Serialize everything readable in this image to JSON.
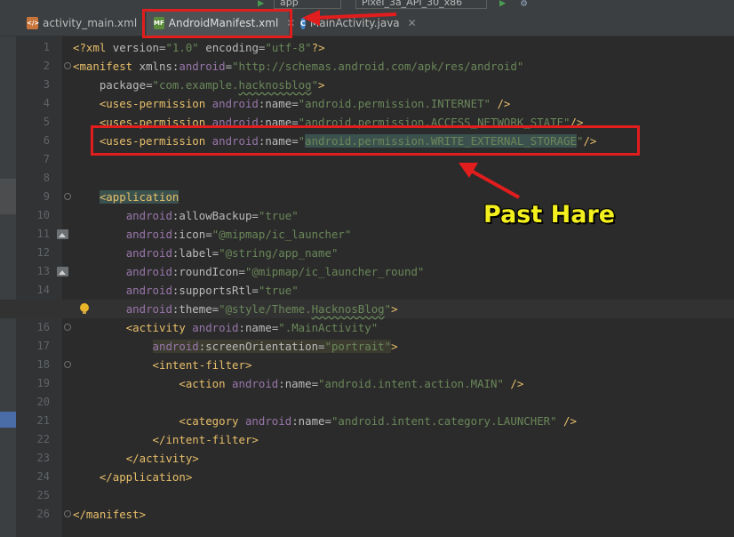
{
  "toolbar": {
    "run_config": "app",
    "device": "Pixel_3a_API_30_x86",
    "icons": [
      "hammer-icon",
      "run-icon",
      "debug-icon"
    ]
  },
  "tabs": [
    {
      "label": "activity_main.xml",
      "icon": "xml-file-icon",
      "active": false
    },
    {
      "label": "AndroidManifest.xml",
      "icon": "manifest-file-icon",
      "active": true
    },
    {
      "label": "MainActivity.java",
      "icon": "java-class-icon",
      "active": false
    }
  ],
  "editor": {
    "line_numbers": [
      "1",
      "2",
      "3",
      "4",
      "5",
      "6",
      "7",
      "8",
      "9",
      "10",
      "11",
      "12",
      "13",
      "14",
      "15",
      "16",
      "17",
      "18",
      "19",
      "20",
      "21",
      "22",
      "23",
      "24",
      "25",
      "26"
    ],
    "current_line": "15",
    "lines": [
      {
        "indent": "",
        "parts": [
          {
            "t": "<?xml ",
            "c": "pi"
          },
          {
            "t": "version",
            "c": "attr"
          },
          {
            "t": "=",
            "c": "attr"
          },
          {
            "t": "\"1.0\"",
            "c": "val"
          },
          {
            "t": " ",
            "c": "attr"
          },
          {
            "t": "encoding",
            "c": "attr"
          },
          {
            "t": "=",
            "c": "attr"
          },
          {
            "t": "\"utf-8\"",
            "c": "val"
          },
          {
            "t": "?>",
            "c": "pi"
          }
        ]
      },
      {
        "indent": "",
        "parts": [
          {
            "t": "<manifest ",
            "c": "tag"
          },
          {
            "t": "xmlns:",
            "c": "attr"
          },
          {
            "t": "android",
            "c": "ns"
          },
          {
            "t": "=",
            "c": "attr"
          },
          {
            "t": "\"http://schemas.android.com/apk/res/android\"",
            "c": "val"
          }
        ]
      },
      {
        "indent": "    ",
        "parts": [
          {
            "t": "package",
            "c": "attr"
          },
          {
            "t": "=",
            "c": "attr"
          },
          {
            "t": "\"com.example.",
            "c": "val"
          },
          {
            "t": "hacknosblog",
            "c": "val-ul"
          },
          {
            "t": "\"",
            "c": "val"
          },
          {
            "t": ">",
            "c": "tag"
          }
        ]
      },
      {
        "indent": "    ",
        "parts": [
          {
            "t": "<uses-permission ",
            "c": "tag"
          },
          {
            "t": "android",
            "c": "ns"
          },
          {
            "t": ":name=",
            "c": "attr"
          },
          {
            "t": "\"android.permission.INTERNET\"",
            "c": "val"
          },
          {
            "t": " />",
            "c": "tag"
          }
        ]
      },
      {
        "indent": "    ",
        "parts": [
          {
            "t": "<uses-permission ",
            "c": "tag"
          },
          {
            "t": "android",
            "c": "ns"
          },
          {
            "t": ":name=",
            "c": "attr"
          },
          {
            "t": "\"android.permission.ACCESS_NETWORK_STATE\"",
            "c": "val"
          },
          {
            "t": "/>",
            "c": "tag"
          }
        ]
      },
      {
        "indent": "    ",
        "parts": [
          {
            "t": "<uses-permission ",
            "c": "tag"
          },
          {
            "t": "android",
            "c": "ns"
          },
          {
            "t": ":name=",
            "c": "attr"
          },
          {
            "t": "\"",
            "c": "val"
          },
          {
            "t": "android.permission.WRITE_EXTERNAL_STORAGE",
            "c": "val-hl"
          },
          {
            "t": "\"",
            "c": "val"
          },
          {
            "t": "/>",
            "c": "tag"
          }
        ]
      },
      {
        "indent": "",
        "parts": []
      },
      {
        "indent": "",
        "parts": []
      },
      {
        "indent": "    ",
        "parts": [
          {
            "t": "<application",
            "c": "tag-hl"
          }
        ]
      },
      {
        "indent": "        ",
        "parts": [
          {
            "t": "android",
            "c": "ns"
          },
          {
            "t": ":allowBackup=",
            "c": "attr"
          },
          {
            "t": "\"true\"",
            "c": "val"
          }
        ]
      },
      {
        "indent": "        ",
        "parts": [
          {
            "t": "android",
            "c": "ns"
          },
          {
            "t": ":icon=",
            "c": "attr"
          },
          {
            "t": "\"@mipmap/ic_launcher\"",
            "c": "val"
          }
        ]
      },
      {
        "indent": "        ",
        "parts": [
          {
            "t": "android",
            "c": "ns"
          },
          {
            "t": ":label=",
            "c": "attr"
          },
          {
            "t": "\"@string/app_name\"",
            "c": "val"
          }
        ]
      },
      {
        "indent": "        ",
        "parts": [
          {
            "t": "android",
            "c": "ns"
          },
          {
            "t": ":roundIcon=",
            "c": "attr"
          },
          {
            "t": "\"@mipmap/ic_launcher_round\"",
            "c": "val"
          }
        ]
      },
      {
        "indent": "        ",
        "parts": [
          {
            "t": "android",
            "c": "ns"
          },
          {
            "t": ":supportsRtl=",
            "c": "attr"
          },
          {
            "t": "\"true\"",
            "c": "val"
          }
        ]
      },
      {
        "indent": "        ",
        "parts": [
          {
            "t": "android",
            "c": "ns"
          },
          {
            "t": ":theme=",
            "c": "attr"
          },
          {
            "t": "\"@style/Theme.",
            "c": "val"
          },
          {
            "t": "HacknosBlog",
            "c": "val-ul"
          },
          {
            "t": "\"",
            "c": "val"
          },
          {
            "t": ">",
            "c": "tag"
          }
        ]
      },
      {
        "indent": "        ",
        "parts": [
          {
            "t": "<activity ",
            "c": "tag"
          },
          {
            "t": "android",
            "c": "ns"
          },
          {
            "t": ":name=",
            "c": "attr"
          },
          {
            "t": "\".MainActivity\"",
            "c": "val"
          }
        ]
      },
      {
        "indent": "            ",
        "parts": [
          {
            "t": "android",
            "c": "ns-bg"
          },
          {
            "t": ":screenOrientation=",
            "c": "attr-bg"
          },
          {
            "t": "\"portrait\"",
            "c": "val-bg"
          },
          {
            "t": ">",
            "c": "tag"
          }
        ]
      },
      {
        "indent": "            ",
        "parts": [
          {
            "t": "<intent-filter>",
            "c": "tag"
          }
        ]
      },
      {
        "indent": "                ",
        "parts": [
          {
            "t": "<action ",
            "c": "tag"
          },
          {
            "t": "android",
            "c": "ns"
          },
          {
            "t": ":name=",
            "c": "attr"
          },
          {
            "t": "\"android.intent.action.MAIN\"",
            "c": "val"
          },
          {
            "t": " />",
            "c": "tag"
          }
        ]
      },
      {
        "indent": "",
        "parts": []
      },
      {
        "indent": "                ",
        "parts": [
          {
            "t": "<category ",
            "c": "tag"
          },
          {
            "t": "android",
            "c": "ns"
          },
          {
            "t": ":name=",
            "c": "attr"
          },
          {
            "t": "\"android.intent.category.LAUNCHER\"",
            "c": "val"
          },
          {
            "t": " />",
            "c": "tag"
          }
        ]
      },
      {
        "indent": "            ",
        "parts": [
          {
            "t": "</intent-filter>",
            "c": "tag"
          }
        ]
      },
      {
        "indent": "        ",
        "parts": [
          {
            "t": "</activity>",
            "c": "tag"
          }
        ]
      },
      {
        "indent": "    ",
        "parts": [
          {
            "t": "</application>",
            "c": "tag"
          }
        ]
      },
      {
        "indent": "",
        "parts": []
      },
      {
        "indent": "",
        "parts": [
          {
            "t": "</manifest>",
            "c": "tag"
          }
        ]
      }
    ]
  },
  "annotation": {
    "note_text": "Past Hare",
    "color": "#e21d1d",
    "note_color": "#f4f01e"
  }
}
